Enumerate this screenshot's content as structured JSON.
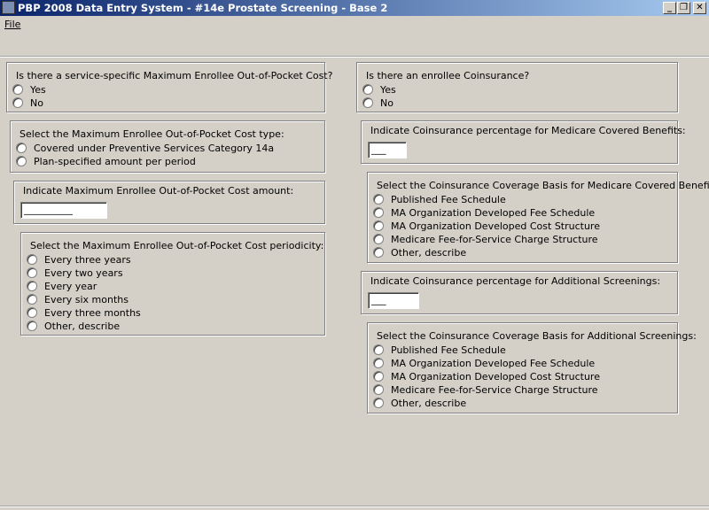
{
  "window": {
    "title": "PBP 2008 Data Entry System - #14e Prostate Screening - Base 2",
    "min": "_",
    "restore": "❐",
    "close": "✕"
  },
  "menu": {
    "file": "File"
  },
  "left": {
    "moop": {
      "question": "Is there a service-specific Maximum Enrollee Out-of-Pocket Cost?",
      "options": [
        "Yes",
        "No"
      ]
    },
    "moop_type": {
      "question": "Select the Maximum Enrollee Out-of-Pocket Cost type:",
      "options": [
        "Covered under Preventive Services Category 14a",
        "Plan-specified amount per period"
      ]
    },
    "moop_amount": {
      "question": "Indicate Maximum Enrollee Out-of-Pocket Cost amount:",
      "value": "__________"
    },
    "periodicity": {
      "question": "Select the Maximum Enrollee Out-of-Pocket Cost periodicity:",
      "options": [
        "Every three years",
        "Every two years",
        "Every year",
        "Every six months",
        "Every three months",
        "Other, describe"
      ]
    }
  },
  "right": {
    "coins": {
      "question": "Is there an enrollee Coinsurance?",
      "options": [
        "Yes",
        "No"
      ]
    },
    "coins_medicare": {
      "question": "Indicate Coinsurance percentage for Medicare Covered Benefits:",
      "value": "___"
    },
    "basis_medicare": {
      "question": "Select the Coinsurance Coverage Basis for Medicare Covered Benefits:",
      "options": [
        "Published Fee Schedule",
        "MA Organization Developed Fee Schedule",
        "MA Organization Developed Cost Structure",
        "Medicare Fee-for-Service Charge Structure",
        "Other, describe"
      ]
    },
    "coins_additional": {
      "question": "Indicate Coinsurance percentage for Additional Screenings:",
      "value": "___"
    },
    "basis_additional": {
      "question": "Select the Coinsurance Coverage Basis for Additional Screenings:",
      "options": [
        "Published Fee Schedule",
        "MA Organization Developed Fee Schedule",
        "MA Organization Developed Cost Structure",
        "Medicare Fee-for-Service Charge Structure",
        "Other, describe"
      ]
    }
  }
}
